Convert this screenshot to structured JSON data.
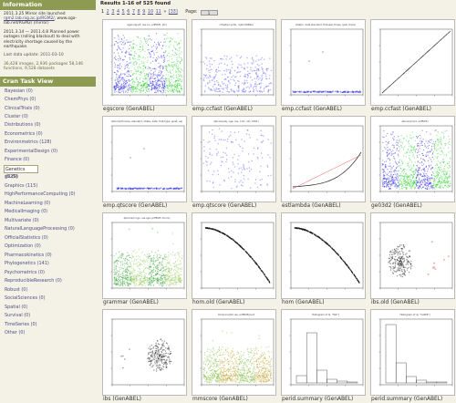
{
  "sidebar": {
    "info_heading": "Information",
    "news": [
      {
        "before": "2011.3.25 Mirror site launched ",
        "link": "rgm2.lab.nig.ac.jp/RGM2/",
        "after": ", www.oga-lab.net/RGM2/ (mirror)"
      },
      {
        "before": "2011.3.14 — 2011.4.8 Planned power outages (rolling blackout) to deal with electricity shortage caused by the earthquake.",
        "link": "",
        "after": ""
      }
    ],
    "last_update": "Last data update: 2011-03-10",
    "stats": "36,428 images, 2,936 packages 58,146 functions, 9,528 datasets",
    "task_view_heading": "Cran Task View",
    "task_views": [
      {
        "label": "Bayesian (0)",
        "active": false
      },
      {
        "label": "ChemPhys (0)",
        "active": false
      },
      {
        "label": "ClinicalTrials (0)",
        "active": false
      },
      {
        "label": "Cluster (0)",
        "active": false
      },
      {
        "label": "Distributions (0)",
        "active": false
      },
      {
        "label": "Econometrics (0)",
        "active": false
      },
      {
        "label": "Environmetrics (128)",
        "active": false
      },
      {
        "label": "ExperimentalDesign (0)",
        "active": false
      },
      {
        "label": "Finance (0)",
        "active": false
      },
      {
        "label": "Genetics (525)",
        "active": true
      },
      {
        "label": "gR (0)",
        "active": false
      },
      {
        "label": "Graphics (115)",
        "active": false
      },
      {
        "label": "HighPerformanceComputing (0)",
        "active": false
      },
      {
        "label": "MachineLearning (0)",
        "active": false
      },
      {
        "label": "MedicalImaging (0)",
        "active": false
      },
      {
        "label": "Multivariate (0)",
        "active": false
      },
      {
        "label": "NaturalLanguageProcessing (0)",
        "active": false
      },
      {
        "label": "OfficialStatistics (0)",
        "active": false
      },
      {
        "label": "Optimization (0)",
        "active": false
      },
      {
        "label": "Pharmacokinetics (0)",
        "active": false
      },
      {
        "label": "Phylogenetics (141)",
        "active": false
      },
      {
        "label": "Psychometrics (0)",
        "active": false
      },
      {
        "label": "ReproducibleResearch (0)",
        "active": false
      },
      {
        "label": "Robust (0)",
        "active": false
      },
      {
        "label": "SocialSciences (0)",
        "active": false
      },
      {
        "label": "Spatial (0)",
        "active": false
      },
      {
        "label": "Survival (0)",
        "active": false
      },
      {
        "label": "TimeSeries (0)",
        "active": false
      },
      {
        "label": "Other (0)",
        "active": false
      }
    ]
  },
  "results": {
    "heading": "Results 1-16 of 525 found",
    "pages": [
      "1",
      "2",
      "3",
      "4",
      "5",
      "6",
      "7",
      "8",
      "9",
      "10",
      "11"
    ],
    "current_page": "1",
    "more": "»",
    "last_page": "[33]",
    "page_label": "Page:",
    "page_select_value": "1"
  },
  "thumbnails": [
    {
      "name": "egscore",
      "pkg": "(GenABEL)",
      "kind": "manhattan",
      "plot_title": "egscore(snf, res.ciu, pdf56l5, phi)"
    },
    {
      "name": "emp.ccfast",
      "pkg": "(GenABEL)",
      "kind": "scatter",
      "plot_title": "ccfast(pc.pcifu, n(ebi 6669e)"
    },
    {
      "name": "emp.ccfast",
      "pkg": "(GenABEL)",
      "kind": "flat",
      "plot_title": "cfast(x, data standard, thisnew) times, qual, trace)"
    },
    {
      "name": "emp.ccfast",
      "pkg": "(GenABEL)",
      "kind": "diagonal",
      "plot_title": ""
    },
    {
      "name": "emp.qtscore",
      "pkg": "(GenABEL)",
      "kind": "flat2",
      "plot_title": "qtscore(formula, standard, strata, data, trait.type, quiet, se)"
    },
    {
      "name": "emp.qtscore",
      "pkg": "(GenABEL)",
      "kind": "scatter2",
      "plot_title": "qtscore(obj, nge, res, ccdc, stn, 1091)"
    },
    {
      "name": "estlambda",
      "pkg": "(GenABEL)",
      "kind": "qq",
      "plot_title": ""
    },
    {
      "name": "ge03d2",
      "pkg": "(GenABEL)",
      "kind": "manhattan2",
      "plot_title": "qtscore(mod, pdf56l5)"
    },
    {
      "name": "grammar",
      "pkg": "(GenABEL)",
      "kind": "manhattan3",
      "plot_title": "qtscore(h.ngo, res.nge, pdf56l5 chrom)"
    },
    {
      "name": "hom.old",
      "pkg": "(GenABEL)",
      "kind": "curve",
      "plot_title": ""
    },
    {
      "name": "hom",
      "pkg": "(GenABEL)",
      "kind": "curve",
      "plot_title": ""
    },
    {
      "name": "ibs.old",
      "pkg": "(GenABEL)",
      "kind": "cluster",
      "plot_title": ""
    },
    {
      "name": "ibs",
      "pkg": "(GenABEL)",
      "kind": "cluster2",
      "plot_title": ""
    },
    {
      "name": "mmscore",
      "pkg": "(GenABEL)",
      "kind": "manhattan4",
      "plot_title": "mmscore(hm,res, pdf56l5)/sort"
    },
    {
      "name": "perid.summary",
      "pkg": "(GenABEL)",
      "kind": "hist",
      "plot_title": "Histogram of dj, \"Het\"]"
    },
    {
      "name": "perid.summary",
      "pkg": "(GenABEL)",
      "kind": "hist2",
      "plot_title": "Histogram of dj, \"CallPP\"]"
    }
  ]
}
